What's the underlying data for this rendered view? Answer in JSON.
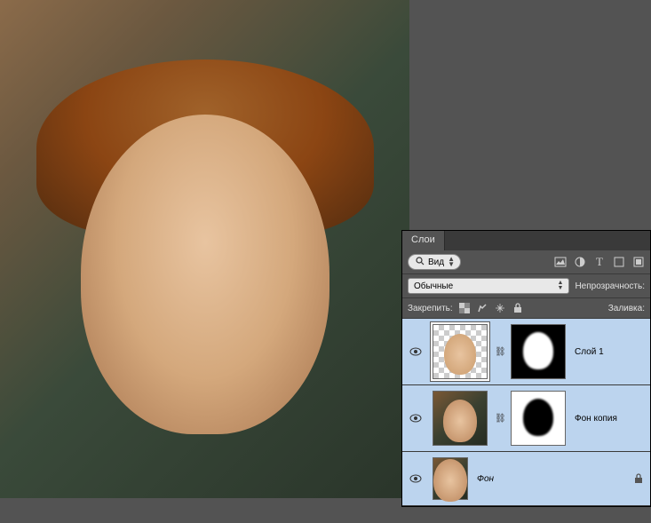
{
  "panel": {
    "tab": "Слои",
    "filter_label": "Вид",
    "blend_mode": "Обычные",
    "opacity_label": "Непрозрачность:",
    "lock_label": "Закрепить:",
    "fill_label": "Заливка:"
  },
  "layers": [
    {
      "name": "Слой 1",
      "visible": true,
      "has_mask": true,
      "mask_style": "white-oval",
      "thumb_style": "face-checker",
      "selected": true
    },
    {
      "name": "Фон копия",
      "visible": true,
      "has_mask": true,
      "mask_style": "black-oval",
      "thumb_style": "portrait-hole",
      "selected": false
    },
    {
      "name": "Фон",
      "visible": true,
      "has_mask": false,
      "thumb_style": "portrait",
      "selected": false,
      "locked": true
    }
  ]
}
